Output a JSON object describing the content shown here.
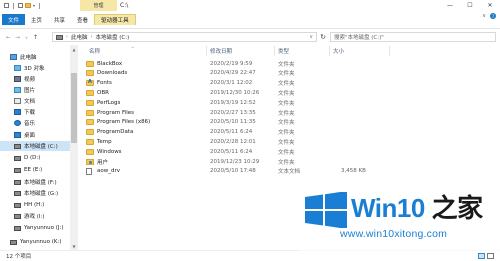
{
  "titlebar": {
    "context_tab": "管理",
    "title": "C:\\",
    "buttons": [
      "—",
      "☐",
      "✕"
    ]
  },
  "ribbon": {
    "tabs": [
      "文件",
      "主页",
      "共享",
      "查看",
      "驱动器工具"
    ],
    "right": "∨"
  },
  "address": {
    "crumbs": [
      "此电脑",
      "本地磁盘 (C:)"
    ],
    "search_placeholder": "搜索\"本地磁盘 (C:)\""
  },
  "nav": {
    "items": [
      {
        "label": "此电脑",
        "icon": "pc-icon"
      },
      {
        "label": "3D 对象",
        "icon": "3d-objects-icon"
      },
      {
        "label": "视频",
        "icon": "video-icon"
      },
      {
        "label": "图片",
        "icon": "pictures-icon"
      },
      {
        "label": "文档",
        "icon": "documents-icon"
      },
      {
        "label": "下载",
        "icon": "download-icon"
      },
      {
        "label": "音乐",
        "icon": "music-icon"
      },
      {
        "label": "桌面",
        "icon": "desktop-icon"
      },
      {
        "label": "本地磁盘 (C:)",
        "icon": "drive-icon"
      },
      {
        "label": "D (D:)",
        "icon": "drive-icon"
      },
      {
        "label": "EE (E:)",
        "icon": "drive-icon"
      },
      {
        "label": "本地磁盘 (F:)",
        "icon": "drive-icon"
      },
      {
        "label": "本地磁盘 (G:)",
        "icon": "drive-icon"
      },
      {
        "label": "HH (H:)",
        "icon": "drive-icon"
      },
      {
        "label": "游戏 (I:)",
        "icon": "drive-icon"
      },
      {
        "label": "Yanyunnuo (J:)",
        "icon": "drive-icon"
      },
      {
        "label": "Yanyunnuo (K:)",
        "icon": "drive-icon"
      }
    ]
  },
  "columns": [
    "名称",
    "修改日期",
    "类型",
    "大小"
  ],
  "files": [
    {
      "name": "BlackBox",
      "date": "2020/2/19 9:59",
      "type": "文件夹",
      "size": "",
      "kind": "folder"
    },
    {
      "name": "Downloads",
      "date": "2020/4/29 22:47",
      "type": "文件夹",
      "size": "",
      "kind": "folder"
    },
    {
      "name": "Fonts",
      "date": "2020/3/1 12:02",
      "type": "文件夹",
      "size": "",
      "kind": "font"
    },
    {
      "name": "OBR",
      "date": "2019/12/30 10:26",
      "type": "文件夹",
      "size": "",
      "kind": "folder"
    },
    {
      "name": "PerfLogs",
      "date": "2019/3/19 12:52",
      "type": "文件夹",
      "size": "",
      "kind": "folder"
    },
    {
      "name": "Program Files",
      "date": "2020/2/27 13:35",
      "type": "文件夹",
      "size": "",
      "kind": "folder"
    },
    {
      "name": "Program Files (x86)",
      "date": "2020/5/10 11:35",
      "type": "文件夹",
      "size": "",
      "kind": "folder"
    },
    {
      "name": "ProgramData",
      "date": "2020/5/11 6:24",
      "type": "文件夹",
      "size": "",
      "kind": "folder"
    },
    {
      "name": "Temp",
      "date": "2020/2/28 12:01",
      "type": "文件夹",
      "size": "",
      "kind": "folder"
    },
    {
      "name": "Windows",
      "date": "2020/5/11 6:24",
      "type": "文件夹",
      "size": "",
      "kind": "folder"
    },
    {
      "name": "用户",
      "date": "2019/12/23 10:29",
      "type": "文件夹",
      "size": "",
      "kind": "user"
    },
    {
      "name": "aow_drv",
      "date": "2020/5/10 17:48",
      "type": "文本文档",
      "size": "3,458 KB",
      "kind": "file"
    }
  ],
  "status": {
    "count": "12 个项目"
  },
  "watermark": {
    "brand_prefix": "Win10",
    "brand_suffix": " 之家",
    "url": "www.win10xitong.com",
    "colors": {
      "blue": "#1a7fd4",
      "dark": "#1a1a1a"
    }
  }
}
